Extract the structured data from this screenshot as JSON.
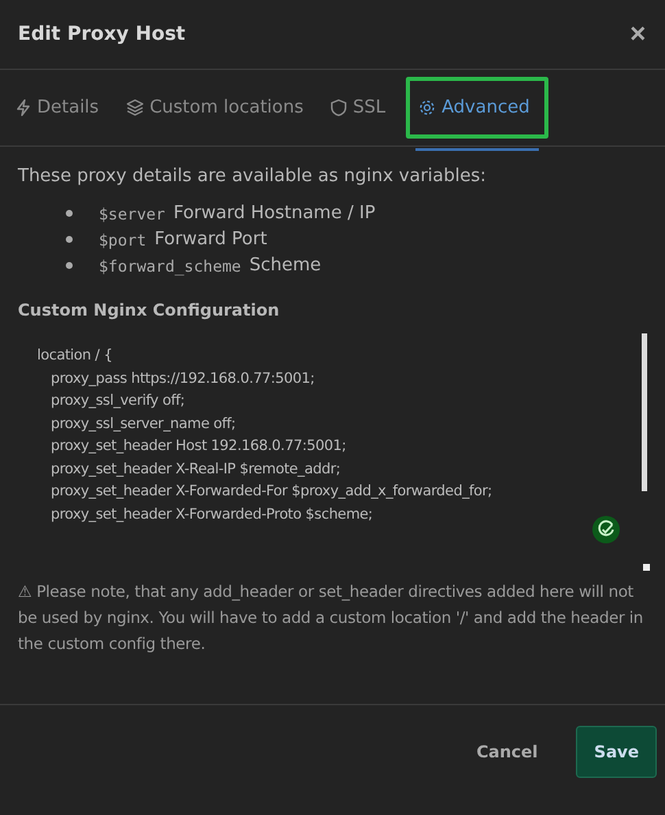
{
  "window": {
    "title": "Edit Proxy Host",
    "close": "×"
  },
  "tabs": [
    {
      "label": "Details",
      "kind": "bolt",
      "selected": false,
      "highlighted": false
    },
    {
      "label": "Custom locations",
      "kind": "layers",
      "selected": false,
      "highlighted": false
    },
    {
      "label": "SSL",
      "kind": "shield",
      "selected": false,
      "highlighted": false
    },
    {
      "label": "Advanced",
      "kind": "gear",
      "selected": true,
      "highlighted": true
    }
  ],
  "intro": "These proxy details are available as nginx variables:",
  "variables": [
    {
      "name": "$server",
      "description": "Forward Hostname / IP"
    },
    {
      "name": "$port",
      "description": "Forward Port"
    },
    {
      "name": "$forward_scheme",
      "description": "Scheme"
    }
  ],
  "config_label": "Custom Nginx Configuration",
  "config_lines": [
    {
      "text": "location / {",
      "indent": false
    },
    {
      "text": "proxy_pass https://192.168.0.77:5001;",
      "indent": true
    },
    {
      "text": "proxy_ssl_verify off;",
      "indent": true
    },
    {
      "text": "proxy_ssl_server_name off;",
      "indent": true
    },
    {
      "text": "proxy_set_header Host 192.168.0.77:5001;",
      "indent": true
    },
    {
      "text": "proxy_set_header X-Real-IP $remote_addr;",
      "indent": true
    },
    {
      "text": "proxy_set_header X-Forwarded-For $proxy_add_x_forwarded_for;",
      "indent": true
    },
    {
      "text": "proxy_set_header X-Forwarded-Proto $scheme;",
      "indent": true
    }
  ],
  "note": "⚠ Please note, that any add_header or set_header directives added here will not be used by nginx. You will have to add a custom location '/' and add the header in the custom config there.",
  "buttons": [
    {
      "label": "Cancel",
      "kind": "secondary"
    },
    {
      "label": "Save",
      "kind": "primary"
    }
  ]
}
